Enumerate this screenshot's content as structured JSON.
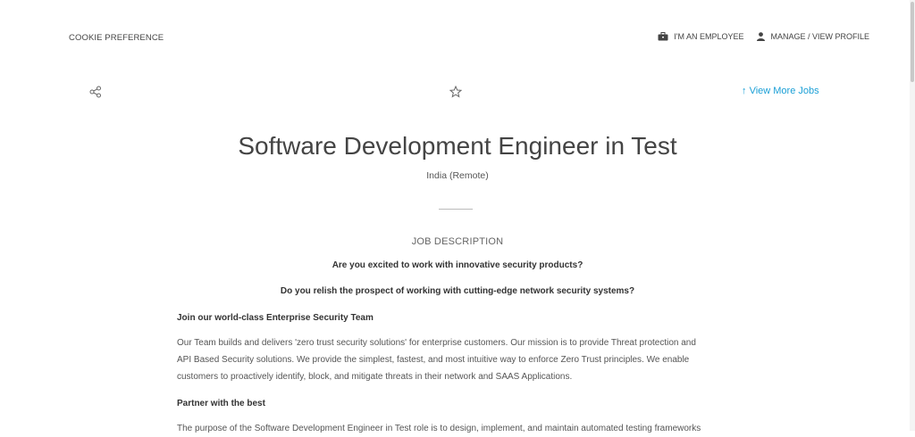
{
  "header": {
    "cookie_preference": "COOKIE PREFERENCE",
    "employee_link": "I'M AN EMPLOYEE",
    "profile_link": "MANAGE / VIEW PROFILE"
  },
  "actions": {
    "view_more_jobs": "View More Jobs",
    "view_more_arrow": "↑"
  },
  "job": {
    "title": "Software Development Engineer in Test",
    "location": "India (Remote)",
    "description_heading": "JOB DESCRIPTION",
    "question1": "Are you excited to work with innovative security products?",
    "question2": "Do you relish the prospect of working with cutting-edge network security systems?",
    "section1_heading": "Join our world-class Enterprise Security Team",
    "section1_line1": "Our Team builds and delivers 'zero trust security solutions' for enterprise customers. Our mission is to provide Threat protection and",
    "section1_line2": "API Based Security solutions. We provide the simplest, fastest, and most intuitive way to enforce Zero Trust principles. We enable",
    "section1_line3": "customers to proactively identify, block, and mitigate threats in their network and SAAS Applications.",
    "section2_heading": "Partner with the best",
    "section2_line1": "The purpose of the Software Development Engineer in Test role is to design, implement, and maintain automated testing frameworks"
  },
  "colors": {
    "accent": "#1a9fd6",
    "text": "#555555"
  },
  "icons": [
    "briefcase-icon",
    "user-icon",
    "share-icon",
    "star-icon"
  ]
}
